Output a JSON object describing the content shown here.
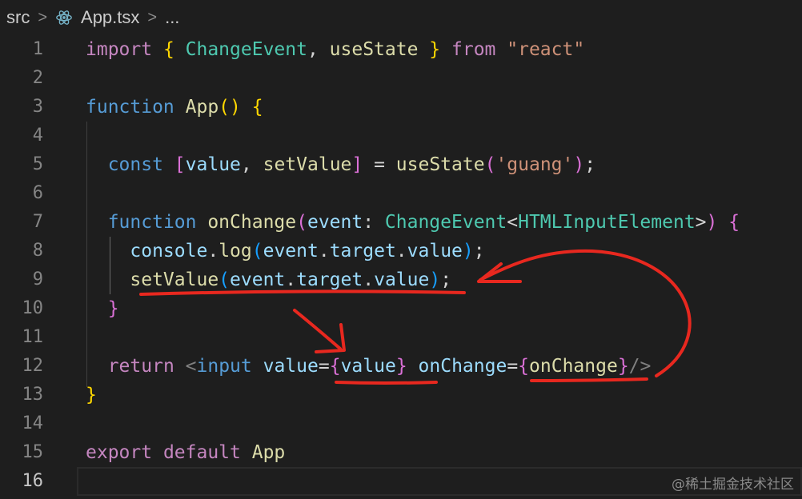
{
  "breadcrumb": {
    "folder": "src",
    "file_icon": "react-icon",
    "file": "App.tsx",
    "more": "..."
  },
  "editor": {
    "active_line": 16,
    "lines": [
      {
        "n": "1",
        "tokens": [
          [
            "kw2",
            "import "
          ],
          [
            "br1",
            "{ "
          ],
          [
            "type",
            "ChangeEvent"
          ],
          [
            "punc",
            ", "
          ],
          [
            "fn",
            "useState"
          ],
          [
            "br1",
            " }"
          ],
          [
            "kw2",
            " from "
          ],
          [
            "str",
            "\"react\""
          ]
        ]
      },
      {
        "n": "2",
        "tokens": []
      },
      {
        "n": "3",
        "tokens": [
          [
            "kw",
            "function "
          ],
          [
            "fn",
            "App"
          ],
          [
            "br1",
            "() {"
          ]
        ]
      },
      {
        "n": "4",
        "tokens": []
      },
      {
        "n": "5",
        "tokens": [
          [
            "punc",
            "  "
          ],
          [
            "kw",
            "const "
          ],
          [
            "br2",
            "["
          ],
          [
            "var",
            "value"
          ],
          [
            "punc",
            ", "
          ],
          [
            "fn",
            "setValue"
          ],
          [
            "br2",
            "]"
          ],
          [
            "punc",
            " = "
          ],
          [
            "fn",
            "useState"
          ],
          [
            "br2",
            "("
          ],
          [
            "str",
            "'guang'"
          ],
          [
            "br2",
            ")"
          ],
          [
            "punc",
            ";"
          ]
        ]
      },
      {
        "n": "6",
        "tokens": []
      },
      {
        "n": "7",
        "tokens": [
          [
            "punc",
            "  "
          ],
          [
            "kw",
            "function "
          ],
          [
            "fn",
            "onChange"
          ],
          [
            "br2",
            "("
          ],
          [
            "var",
            "event"
          ],
          [
            "punc",
            ": "
          ],
          [
            "type",
            "ChangeEvent"
          ],
          [
            "punc",
            "<"
          ],
          [
            "type",
            "HTMLInputElement"
          ],
          [
            "punc",
            ">"
          ],
          [
            "br2",
            ") {"
          ]
        ]
      },
      {
        "n": "8",
        "tokens": [
          [
            "punc",
            "    "
          ],
          [
            "var",
            "console"
          ],
          [
            "punc",
            "."
          ],
          [
            "fn",
            "log"
          ],
          [
            "br3",
            "("
          ],
          [
            "var",
            "event"
          ],
          [
            "punc",
            "."
          ],
          [
            "var",
            "target"
          ],
          [
            "punc",
            "."
          ],
          [
            "var",
            "value"
          ],
          [
            "br3",
            ")"
          ],
          [
            "punc",
            ";"
          ]
        ]
      },
      {
        "n": "9",
        "tokens": [
          [
            "punc",
            "    "
          ],
          [
            "fn",
            "setValue"
          ],
          [
            "br3",
            "("
          ],
          [
            "var",
            "event"
          ],
          [
            "punc",
            "."
          ],
          [
            "var",
            "target"
          ],
          [
            "punc",
            "."
          ],
          [
            "var",
            "value"
          ],
          [
            "br3",
            ")"
          ],
          [
            "punc",
            ";"
          ]
        ]
      },
      {
        "n": "10",
        "tokens": [
          [
            "br2",
            "  }"
          ]
        ]
      },
      {
        "n": "11",
        "tokens": []
      },
      {
        "n": "12",
        "tokens": [
          [
            "punc",
            "  "
          ],
          [
            "kw2",
            "return "
          ],
          [
            "tag",
            "<"
          ],
          [
            "kw",
            "input "
          ],
          [
            "var",
            "value"
          ],
          [
            "punc",
            "="
          ],
          [
            "br2",
            "{"
          ],
          [
            "var",
            "value"
          ],
          [
            "br2",
            "}"
          ],
          [
            "punc",
            " "
          ],
          [
            "var",
            "onChange"
          ],
          [
            "punc",
            "="
          ],
          [
            "br2",
            "{"
          ],
          [
            "fn",
            "onChange"
          ],
          [
            "br2",
            "}"
          ],
          [
            "tag",
            "/>"
          ]
        ]
      },
      {
        "n": "13",
        "tokens": [
          [
            "br1",
            "}"
          ]
        ]
      },
      {
        "n": "14",
        "tokens": []
      },
      {
        "n": "15",
        "tokens": [
          [
            "kw2",
            "export "
          ],
          [
            "kw2",
            "default "
          ],
          [
            "fn",
            "App"
          ]
        ]
      },
      {
        "n": "16",
        "tokens": []
      }
    ]
  },
  "annotation_color": "#e8281f",
  "watermark": "@稀土掘金技术社区"
}
